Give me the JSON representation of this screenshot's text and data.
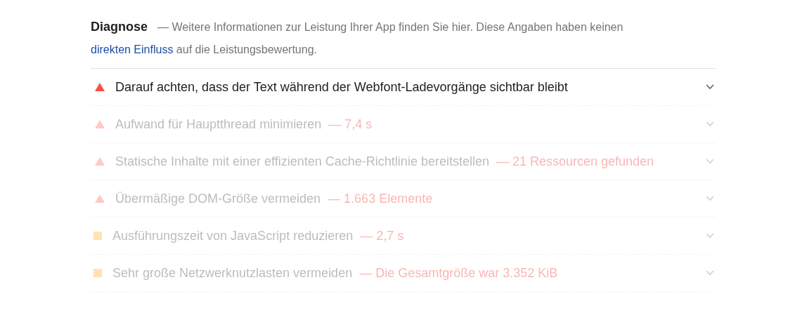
{
  "header": {
    "title": "Diagnose",
    "description_before": "— Weitere Informationen zur Leistung Ihrer App finden Sie hier. Diese Angaben haben keinen",
    "link": "direkten Einfluss",
    "description_after": "auf die Leistungsbewertung."
  },
  "audits": [
    {
      "kind": "fail",
      "title": "Darauf achten, dass der Text während der Webfont-Ladevorgänge sichtbar bleibt",
      "faded": false
    },
    {
      "kind": "fail",
      "title": "Aufwand für Hauptthread minimieren",
      "detail": "— 7,4 s",
      "faded": true
    },
    {
      "kind": "fail",
      "title": "Statische Inhalte mit einer effizienten Cache-Richtlinie bereitstellen",
      "detail": "— 21 Ressourcen gefunden",
      "faded": true
    },
    {
      "kind": "fail",
      "title": "Übermäßige DOM-Größe vermeiden",
      "detail": "— 1.663 Elemente",
      "faded": true
    },
    {
      "kind": "average",
      "title": "Ausführungszeit von JavaScript reduzieren",
      "detail": "— 2,7 s",
      "faded": true
    },
    {
      "kind": "average",
      "title": "Sehr große Netzwerknutzlasten vermeiden",
      "detail": "— Die Gesamtgröße war 3.352 KiB",
      "faded": true
    }
  ]
}
